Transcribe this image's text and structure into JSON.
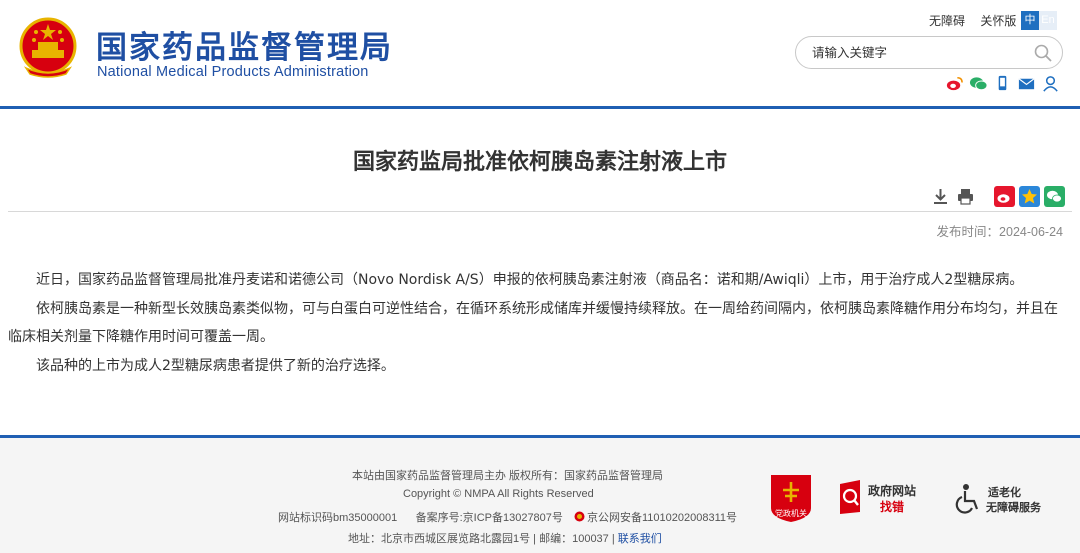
{
  "header": {
    "logo_cn": "国家药品监督管理局",
    "logo_en": "National Medical Products Administration",
    "links": [
      "无障碍",
      "关怀版"
    ],
    "lang": {
      "zh": "中",
      "en": "En"
    },
    "search": {
      "placeholder": "请输入关键字"
    },
    "social_icons": [
      "weibo-icon",
      "wechat-icon",
      "mobile-icon",
      "mail-icon",
      "user-icon"
    ]
  },
  "article": {
    "title": "国家药监局批准依柯胰岛素注射液上市",
    "publish_date": "发布时间：2024-06-24",
    "paragraphs": [
      "近日，国家药品监督管理局批准丹麦诺和诺德公司（Novo Nordisk A/S）申报的依柯胰岛素注射液（商品名：诺和期/Awiqli）上市，用于治疗成人2型糖尿病。",
      "依柯胰岛素是一种新型长效胰岛素类似物，可与白蛋白可逆性结合，在循环系统形成储库并缓慢持续释放。在一周给药间隔内，依柯胰岛素降糖作用分布均匀，并且在临床相关剂量下降糖作用时间可覆盖一周。",
      "该品种的上市为成人2型糖尿病患者提供了新的治疗选择。"
    ],
    "tool_icons": [
      "download-icon",
      "print-icon",
      "weibo-share-icon",
      "qzone-share-icon",
      "wechat-share-icon"
    ]
  },
  "footer": {
    "line1": "本站由国家药品监督管理局主办 版权所有：国家药品监督管理局",
    "line2": "Copyright © NMPA All Rights Reserved",
    "site_id": "网站标识码bm35000001",
    "icp": "备案序号:京ICP备13027807号",
    "police": "京公网安备11010202008311号",
    "address": "地址：北京市西城区展览路北露园1号 | 邮编：100037 |",
    "contact": "联系我们",
    "badge_dzjg": "党政机关",
    "badge_zhaocuo_title": "政府网站",
    "badge_zhaocuo_sub": "找错",
    "badge_old_line1": "适老化",
    "badge_old_line2": "无障碍服务"
  },
  "colors": {
    "brand_blue": "#1f4fa3",
    "rule_blue": "#1f5fb3",
    "red": "#d7000f"
  }
}
